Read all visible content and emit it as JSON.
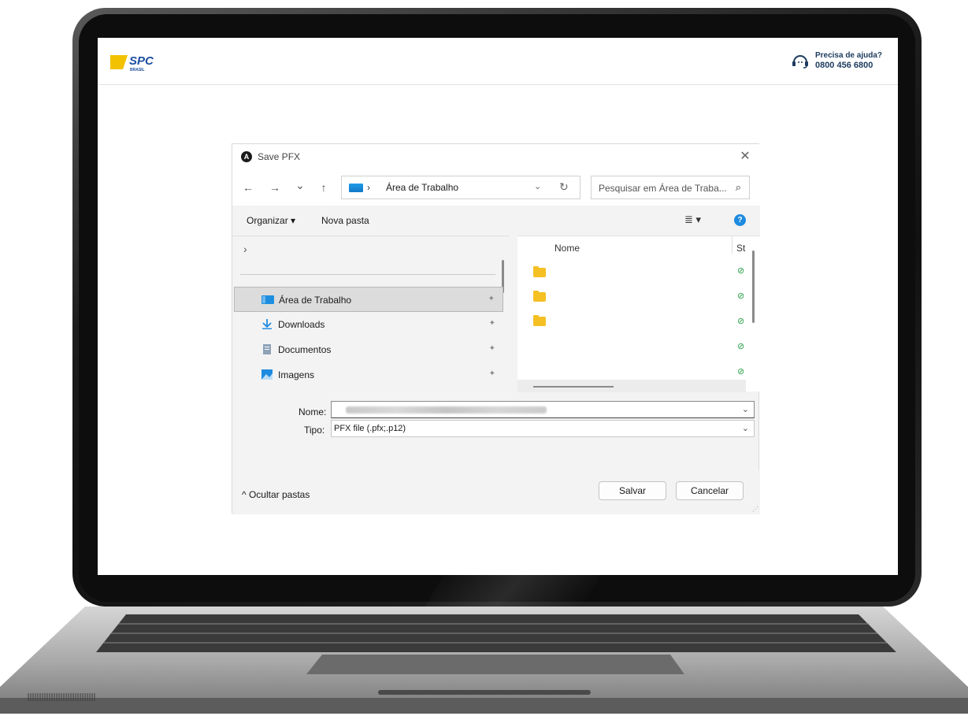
{
  "site": {
    "logo": "SPC",
    "logo_sub": "BRASIL",
    "help_question": "Precisa de ajuda?",
    "help_phone": "0800 456 6800"
  },
  "dialog": {
    "title": "Save PFX",
    "close_glyph": "✕",
    "nav": {
      "back": "←",
      "forward": "→",
      "recent": "⌄",
      "up": "↑"
    },
    "address": {
      "separator": "›",
      "path": "Área de Trabalho",
      "refresh": "↻"
    },
    "search_placeholder": "Pesquisar em Área de Traba...",
    "search_glyph": "⌕",
    "toolbar": {
      "organize": "Organizar ▾",
      "new_folder": "Nova pasta",
      "view": "≣ ▾",
      "help": "?"
    },
    "navpane": {
      "expander": "›",
      "items": [
        {
          "label": "Área de Trabalho",
          "icon": "desktop-icon",
          "selected": true
        },
        {
          "label": "Downloads",
          "icon": "download-icon",
          "selected": false
        },
        {
          "label": "Documentos",
          "icon": "document-icon",
          "selected": false
        },
        {
          "label": "Imagens",
          "icon": "image-icon",
          "selected": false
        }
      ],
      "pin": "📌"
    },
    "files": {
      "col_name": "Nome",
      "col_status": "St",
      "status_glyph": "⊘"
    },
    "name_label": "Nome:",
    "type_label": "Tipo:",
    "type_value": "PFX file (.pfx;.p12)",
    "dropdown_glyph": "⌄",
    "hide_folders": "^ Ocultar pastas",
    "save": "Salvar",
    "cancel": "Cancelar"
  },
  "colors": {
    "accent": "#1e8be0",
    "logo_yellow": "#f2c200",
    "logo_blue": "#1d4fa0",
    "status_green": "#26a046"
  }
}
